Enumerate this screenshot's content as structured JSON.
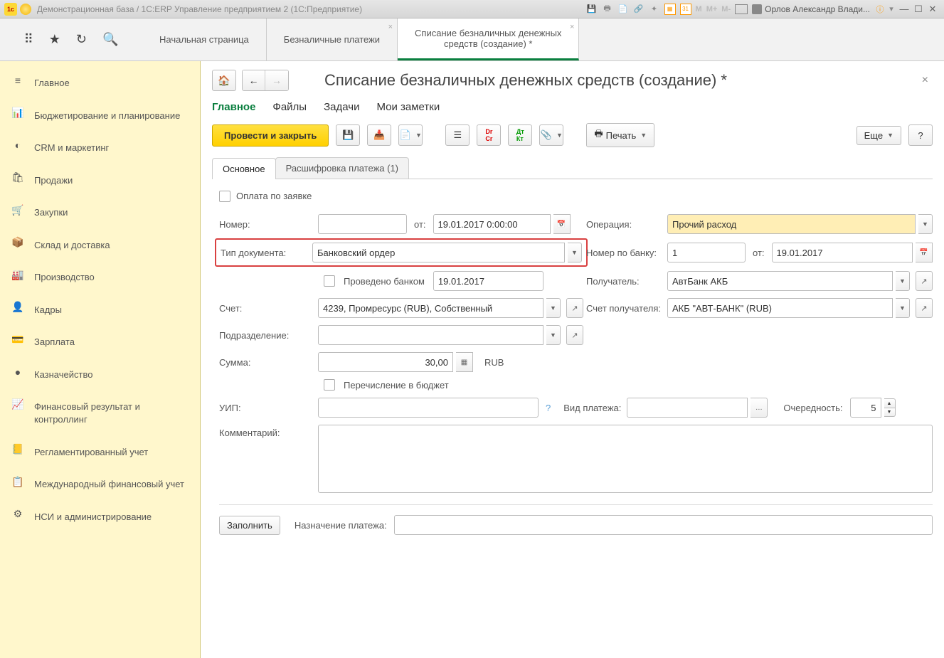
{
  "titlebar": {
    "title": "Демонстрационная база / 1С:ERP Управление предприятием 2  (1С:Предприятие)",
    "user": "Орлов Александр Влади..."
  },
  "top_tabs": {
    "t0": "Начальная страница",
    "t1": "Безналичные платежи",
    "t2_l1": "Списание безналичных денежных",
    "t2_l2": "средств (создание) *"
  },
  "sidebar": {
    "main": "Главное",
    "budget": "Бюджетирование и планирование",
    "crm": "CRM и маркетинг",
    "sales": "Продажи",
    "purch": "Закупки",
    "stock": "Склад и доставка",
    "prod": "Производство",
    "hr": "Кадры",
    "salary": "Зарплата",
    "treasury": "Казначейство",
    "finresult": "Финансовый результат и контроллинг",
    "regacc": "Регламентированный учет",
    "intfin": "Международный финансовый учет",
    "nsi": "НСИ и администрирование"
  },
  "page": {
    "title": "Списание безналичных денежных средств (создание) *",
    "section_tabs": {
      "main": "Главное",
      "files": "Файлы",
      "tasks": "Задачи",
      "notes": "Мои заметки"
    },
    "actions": {
      "post_close": "Провести и закрыть",
      "print": "Печать",
      "more": "Еще"
    },
    "subtabs": {
      "main": "Основное",
      "decode": "Расшифровка платежа (1)"
    }
  },
  "form": {
    "pay_by_request": "Оплата по заявке",
    "number_label": "Номер:",
    "number_value": "",
    "from_label": "от:",
    "date_value": "19.01.2017  0:00:00",
    "operation_label": "Операция:",
    "operation_value": "Прочий расход",
    "doc_type_label": "Тип документа:",
    "doc_type_value": "Банковский ордер",
    "bank_number_label": "Номер по банку:",
    "bank_number_value": "1",
    "bank_from_label": "от:",
    "bank_date_value": "19.01.2017",
    "posted_bank_label": "Проведено банком",
    "posted_bank_date": "19.01.2017",
    "recipient_label": "Получатель:",
    "recipient_value": "АвтБанк АКБ",
    "account_label": "Счет:",
    "account_value": "4239, Промресурс (RUB), Собственный",
    "recip_account_label": "Счет получателя:",
    "recip_account_value": "АКБ \"АВТ-БАНК\" (RUB)",
    "division_label": "Подразделение:",
    "division_value": "",
    "amount_label": "Сумма:",
    "amount_value": "30,00",
    "currency": "RUB",
    "budget_transfer_label": "Перечисление в бюджет",
    "uip_label": "УИП:",
    "uip_value": "",
    "payment_type_label": "Вид платежа:",
    "payment_type_value": "",
    "priority_label": "Очередность:",
    "priority_value": "5",
    "comment_label": "Комментарий:",
    "comment_value": "",
    "purpose_label": "Назначение платежа:",
    "purpose_value": "",
    "fill_btn": "Заполнить"
  }
}
